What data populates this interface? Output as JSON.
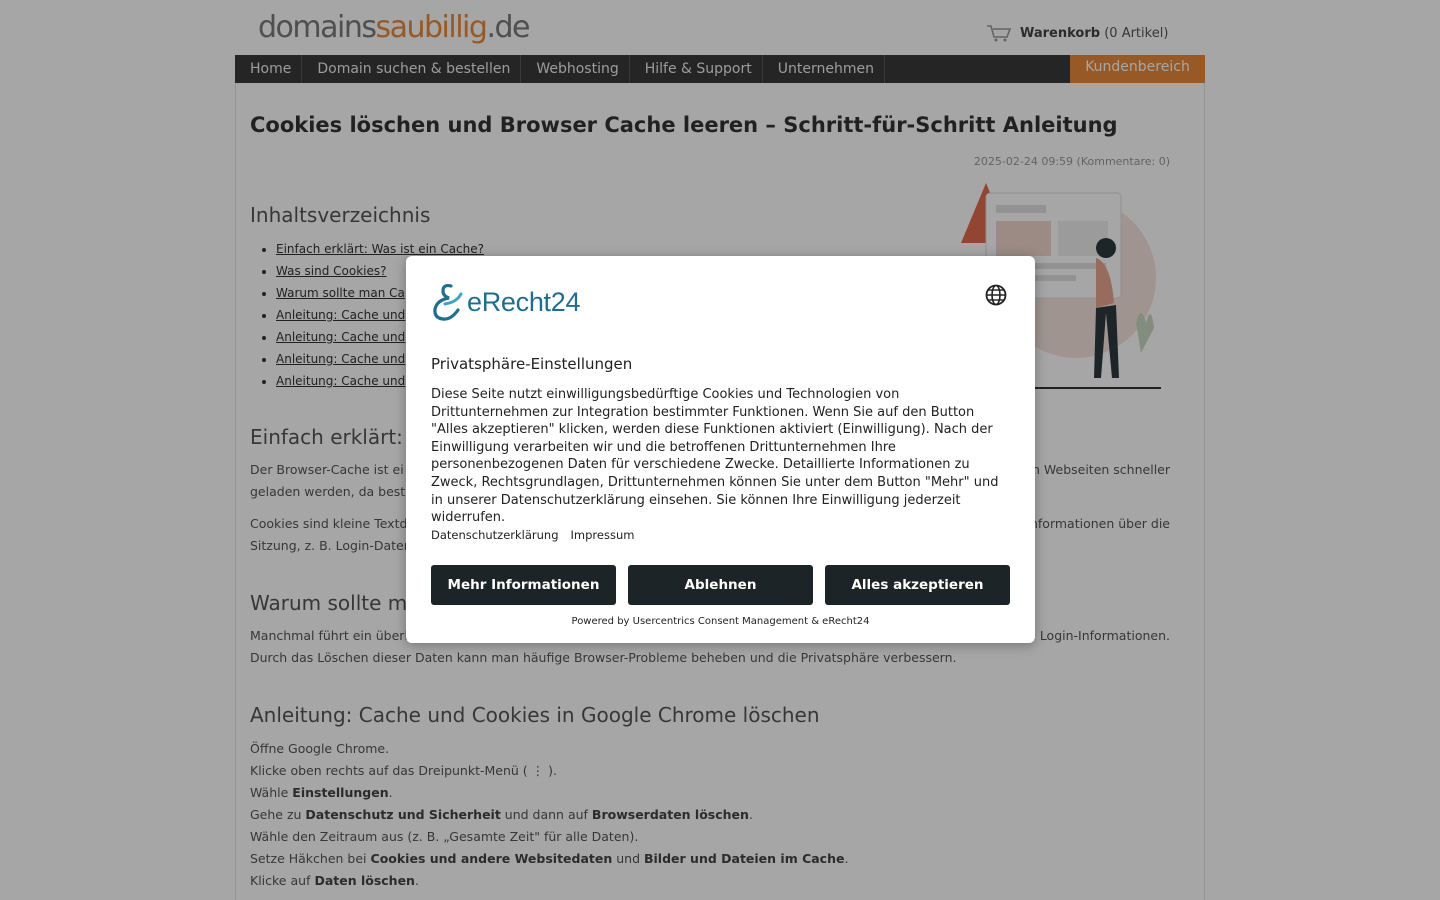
{
  "header": {
    "logo_part1": "domains",
    "logo_part2": "saubillig",
    "logo_part3": ".de",
    "cart_label": "Warenkorb",
    "cart_count": "(0 Artikel)"
  },
  "nav": {
    "items": [
      "Home",
      "Domain suchen & bestellen",
      "Webhosting",
      "Hilfe & Support",
      "Unternehmen"
    ],
    "kunden": "Kundenbereich"
  },
  "article": {
    "title": "Cookies löschen und Browser Cache leeren – Schritt-für-Schritt Anleitung",
    "meta": "2025-02-24 09:59 (Kommentare: 0)",
    "toc_heading": "Inhaltsverzeichnis",
    "toc": [
      "Einfach erklärt: Was ist ein Cache?",
      "Was sind Cookies?",
      "Warum sollte man Ca",
      "Anleitung: Cache und",
      "Anleitung: Cache und",
      "Anleitung: Cache und",
      "Anleitung: Cache und"
    ],
    "s1_heading": "Einfach erklärt:",
    "s1_p1a": "Der Browser-Cache ist ei",
    "s1_p1b": "n Webseiten schneller",
    "s1_p1c": "geladen werden, da bestin",
    "s1_p2a": "Cookies sind kleine Textd",
    "s1_p2b": "nformationen über die",
    "s1_p2c": "Sitzung, z. B. Login-Daten",
    "s2_heading": "Warum sollte m",
    "s2_p1a": "Manchmal führt ein überl",
    "s2_p1b": "n Login-Informationen.",
    "s2_p1c": "Durch das Löschen dieser Daten kann man häufige Browser-Probleme beheben und die Privatsphäre verbessern.",
    "s3_heading": "Anleitung: Cache und Cookies in Google Chrome löschen",
    "steps": {
      "s1": "Öffne Google Chrome.",
      "s2": "Klicke oben rechts auf das Dreipunkt-Menü ( ⋮ ).",
      "s3a": "Wähle ",
      "s3b": "Einstellungen",
      "s3c": ".",
      "s4a": "Gehe zu ",
      "s4b": "Datenschutz und Sicherheit",
      "s4c": " und dann auf ",
      "s4d": "Browserdaten löschen",
      "s4e": ".",
      "s5": "Wähle den Zeitraum aus (z. B. „Gesamte Zeit\" für alle Daten).",
      "s6a": "Setze Häkchen bei ",
      "s6b": "Cookies und andere Websitedaten",
      "s6c": " und ",
      "s6d": "Bilder und Dateien im Cache",
      "s6e": ".",
      "s7a": "Klicke auf ",
      "s7b": "Daten löschen",
      "s7c": "."
    }
  },
  "modal": {
    "brand": "eRecht24",
    "title": "Privatsphäre-Einstellungen",
    "text": "Diese Seite nutzt einwilligungsbedürftige Cookies und Technologien von Drittunternehmen zur Integration bestimmter Funktionen. Wenn Sie auf den Button \"Alles akzeptieren\" klicken, werden diese Funktionen aktiviert (Einwilligung). Nach der Einwilligung verarbeiten wir und die betroffenen Drittunternehmen Ihre personenbezogenen Daten für verschiedene Zwecke. Detaillierte Informationen zu Zweck, Rechtsgrundlagen, Drittunternehmen können Sie unter dem Button \"Mehr\" und in unserer Datenschutzerklärung einsehen. Sie können Ihre Einwilligung jederzeit widerrufen.",
    "link_privacy": "Datenschutzerklärung",
    "link_imprint": "Impressum",
    "btn_more": "Mehr Informationen",
    "btn_deny": "Ablehnen",
    "btn_accept": "Alles akzeptieren",
    "powered": "Powered by Usercentrics Consent Management & eRecht24"
  }
}
